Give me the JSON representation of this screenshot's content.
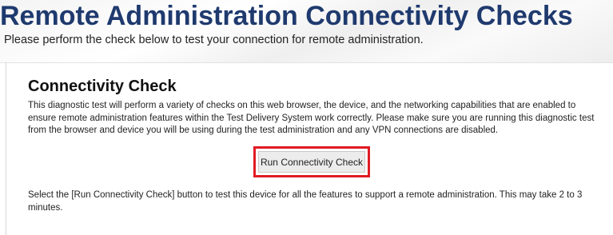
{
  "header": {
    "title": "Remote Administration Connectivity Checks",
    "subtitle": "Please perform the check below to test your connection for remote administration."
  },
  "connectivity_check": {
    "title": "Connectivity Check",
    "description": "This diagnostic test will perform a variety of checks on this web browser, the device, and the networking capabilities that are enabled to ensure remote administration features within the Test Delivery System work correctly. Please make sure you are running this diagnostic test from the browser and device you will be using during the test administration and any VPN connections are disabled.",
    "run_button_label": "Run Connectivity Check",
    "instructions": "Select the [Run Connectivity Check] button to test this device for all the features to support a remote administration. This may take 2 to 3 minutes."
  },
  "colors": {
    "title": "#1f3a6e",
    "highlight_border": "#e01b24",
    "button_background": "#ececec"
  }
}
